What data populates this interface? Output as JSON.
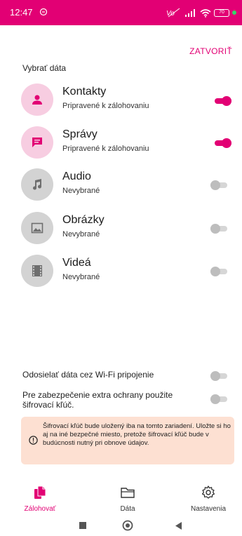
{
  "status_bar": {
    "time": "12:47",
    "battery": "70",
    "brand_color": "#e20074"
  },
  "header": {
    "close_label": "ZATVORIŤ",
    "section_title": "Vybrať dáta"
  },
  "items": [
    {
      "name": "Kontakty",
      "status": "Pripravené k zálohovaniu",
      "icon": "person-icon",
      "enabled": true
    },
    {
      "name": "Správy",
      "status": "Pripravené k zálohovaniu",
      "icon": "message-icon",
      "enabled": true
    },
    {
      "name": "Audio",
      "status": "Nevybrané",
      "icon": "music-note-icon",
      "enabled": false
    },
    {
      "name": "Obrázky",
      "status": "Nevybrané",
      "icon": "image-icon",
      "enabled": false
    },
    {
      "name": "Videá",
      "status": "Nevybrané",
      "icon": "film-icon",
      "enabled": false
    }
  ],
  "settings": {
    "wifi_label": "Odosielať dáta cez Wi-Fi pripojenie",
    "wifi_enabled": false,
    "encryption_label": "Pre zabezpečenie extra ochrany použite šifrovací kľúč.",
    "encryption_enabled": false
  },
  "warning": {
    "text": "Šifrovací kľúč bude uložený iba na tomto zariadení. Uložte si ho aj na iné bezpečné miesto, pretože šifrovací kľúč bude v budúcnosti nutný pri obnove údajov.",
    "background": "#fde0d2"
  },
  "bottom_nav": {
    "items": [
      {
        "label": "Zálohovať",
        "icon": "backup-icon",
        "active": true
      },
      {
        "label": "Dáta",
        "icon": "folder-icon",
        "active": false
      },
      {
        "label": "Nastavenia",
        "icon": "gear-icon",
        "active": false
      }
    ]
  }
}
